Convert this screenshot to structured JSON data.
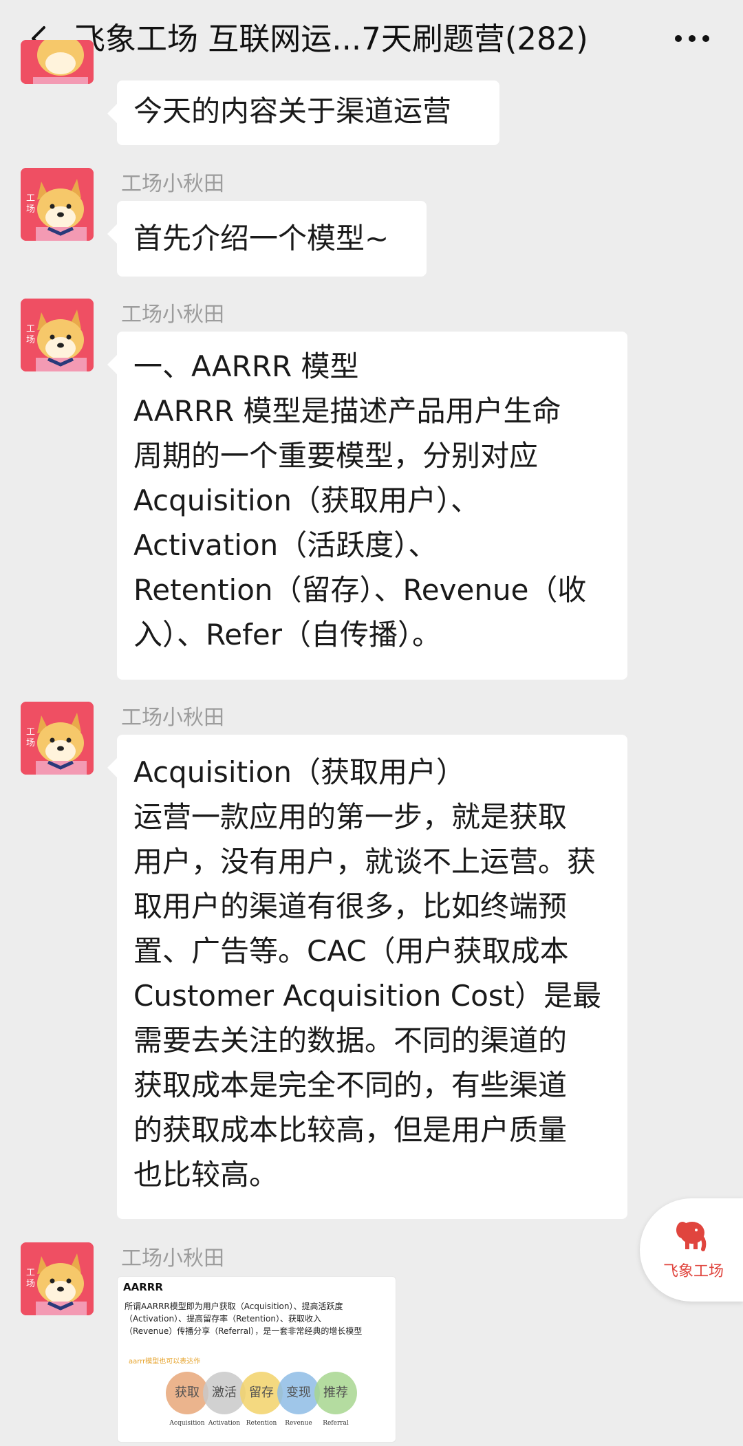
{
  "header": {
    "title": "飞象工场 互联网运...7天刷题营(282)"
  },
  "messages": [
    {
      "sender": "",
      "lines": [
        "今天的内容关于渠道运营"
      ]
    },
    {
      "sender": "工场小秋田",
      "lines": [
        "首先介绍一个模型~"
      ]
    },
    {
      "sender": "工场小秋田",
      "lines": [
        "一、AARRR 模型",
        "AARRR 模型是描述产品用户生命",
        "周期的一个重要模型，分别对应",
        "Acquisition（获取用户）、",
        "Activation（活跃度）、",
        "Retention（留存）、Revenue（收",
        "入）、Refer（自传播）。"
      ]
    },
    {
      "sender": "工场小秋田",
      "lines": [
        "Acquisition（获取用户）",
        "运营一款应用的第一步，就是获取",
        "用户，没有用户，就谈不上运营。获",
        "取用户的渠道有很多，比如终端预",
        "置、广告等。CAC（用户获取成本",
        "Customer Acquisition Cost）是最",
        "需要去关注的数据。不同的渠道的",
        "获取成本是完全不同的，有些渠道",
        "的获取成本比较高，但是用户质量",
        "也比较高。"
      ]
    },
    {
      "sender": "工场小秋田",
      "image": {
        "title": "AARRR",
        "desc_lines": [
          "所谓AARRR模型即为用户获取（Acquisition）、提高活跃度",
          "（Activation）、提高留存率（Retention）、获取收入",
          "（Revenue）传播分享（Referral），是一套非常经典的增长模型"
        ],
        "note": "aarrr模型也可以表达作",
        "circles": [
          {
            "label": "获取",
            "sub": "Acquisition",
            "color": "#e8a77a"
          },
          {
            "label": "激活",
            "sub": "Activation",
            "color": "#c9c9c9"
          },
          {
            "label": "留存",
            "sub": "Retention",
            "color": "#f3d36b"
          },
          {
            "label": "变现",
            "sub": "Revenue",
            "color": "#8fbde6"
          },
          {
            "label": "推荐",
            "sub": "Referral",
            "color": "#a8d690"
          }
        ]
      }
    }
  ],
  "floating_logo": {
    "text": "飞象工场",
    "icon": "elephant-icon",
    "color": "#e0453e"
  },
  "colors": {
    "background": "#ededed",
    "bubble": "#ffffff",
    "avatar": "#ef4f63"
  }
}
